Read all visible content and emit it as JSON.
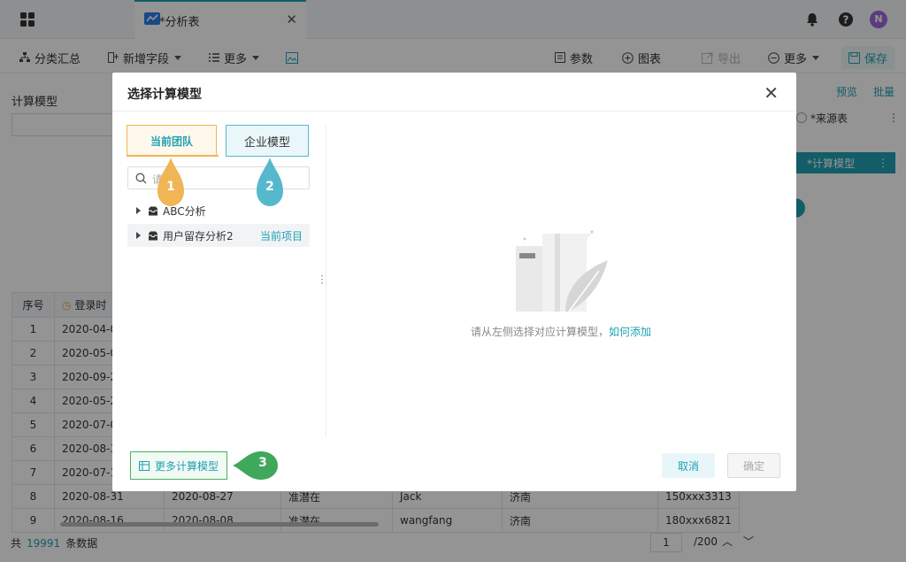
{
  "topbar": {
    "tab_label": "*分析表",
    "tab_close": "✕",
    "avatar_initial": "N"
  },
  "toolbar": {
    "group_summary": "分类汇总",
    "add_field": "新增字段",
    "more_left": "更多",
    "params": "参数",
    "chart": "图表",
    "export": "导出",
    "more_right": "更多",
    "save": "保存"
  },
  "background": {
    "left_title": "计算模型",
    "preview_link": "预览",
    "batch_link": "批量",
    "source_table": "*来源表",
    "calc_model": "*计算模型",
    "more_glyph": "⋮",
    "table": {
      "headers": [
        "序号",
        "登录时"
      ],
      "rows": [
        {
          "no": "1",
          "c1": "2020-04-0"
        },
        {
          "no": "2",
          "c1": "2020-05-0"
        },
        {
          "no": "3",
          "c1": "2020-09-2"
        },
        {
          "no": "4",
          "c1": "2020-05-2"
        },
        {
          "no": "5",
          "c1": "2020-07-0"
        },
        {
          "no": "6",
          "c1": "2020-08-3"
        },
        {
          "no": "7",
          "c1": "2020-07-1"
        },
        {
          "no": "8",
          "c1": "2020-08-31",
          "c2": "2020-08-27",
          "c3": "准潜在",
          "c4": "Jack",
          "c5": "济南",
          "c6": "150xxx3313"
        },
        {
          "no": "9",
          "c1": "2020-08-16",
          "c2": "2020-08-08",
          "c3": "准潜在",
          "c4": "wangfang",
          "c5": "济南",
          "c6": "180xxx6821"
        }
      ]
    },
    "footer": {
      "total_prefix": "共",
      "total_count": "19991",
      "total_suffix": "条数据",
      "page_current": "1",
      "page_total": "/200"
    }
  },
  "modal": {
    "title": "选择计算模型",
    "close": "✕",
    "tab_team": "当前团队",
    "tab_enterprise": "企业模型",
    "search_placeholder": "请",
    "tree": [
      {
        "label": "ABC分析",
        "badge": ""
      },
      {
        "label": "用户留存分析2",
        "badge": "当前项目"
      }
    ],
    "empty_text": "请从左侧选择对应计算模型，",
    "empty_link": "如何添加",
    "more_models": "更多计算模型",
    "cancel": "取消",
    "ok": "确定"
  },
  "markers": {
    "m1": "1",
    "m2": "2",
    "m3": "3",
    "color_orange": "#f0b554",
    "color_teal": "#56b8cd",
    "color_green": "#3fa85a"
  }
}
